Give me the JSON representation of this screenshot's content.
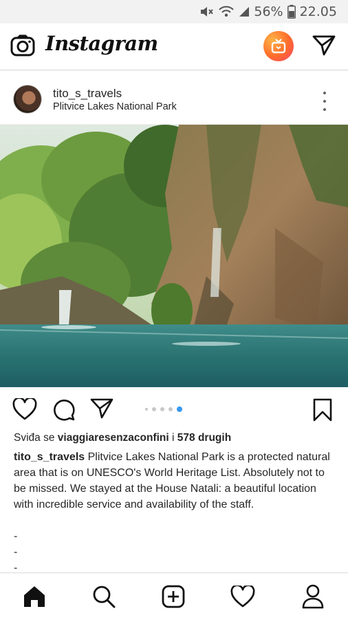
{
  "status_bar": {
    "battery": "56%",
    "time": "22.05",
    "icons": [
      "mute-icon",
      "wifi-icon",
      "signal-icon",
      "battery-icon"
    ]
  },
  "header": {
    "logo_text": "Instagram",
    "icons": [
      "camera-icon",
      "igtv-icon",
      "direct-message-icon"
    ]
  },
  "post": {
    "username": "tito_s_travels",
    "location": "Plitvice Lakes National Park",
    "image_alt": "waterfall-photo",
    "carousel": {
      "count": 5,
      "active_index": 4
    },
    "likes": {
      "prefix": "Sviđa se",
      "liker": "viaggiaresenzaconfini",
      "joiner": "i",
      "others": "578 drugih"
    },
    "caption": {
      "author": "tito_s_travels",
      "text": "Plitvice Lakes National Park is a protected natural area that is on UNESCO's World Heritage List. Absolutely not to be missed. We stayed at the House Natali: a beautiful location with incredible service and availability of the staff."
    },
    "dash_lines": [
      "-",
      "-",
      "-"
    ]
  },
  "bottom_nav": {
    "items": [
      "home-icon",
      "search-icon",
      "new-post-icon",
      "activity-icon",
      "profile-icon"
    ]
  },
  "colors": {
    "text": "#262626",
    "accent_blue": "#3897f0",
    "igtv_orange": "#ff6b2b"
  }
}
